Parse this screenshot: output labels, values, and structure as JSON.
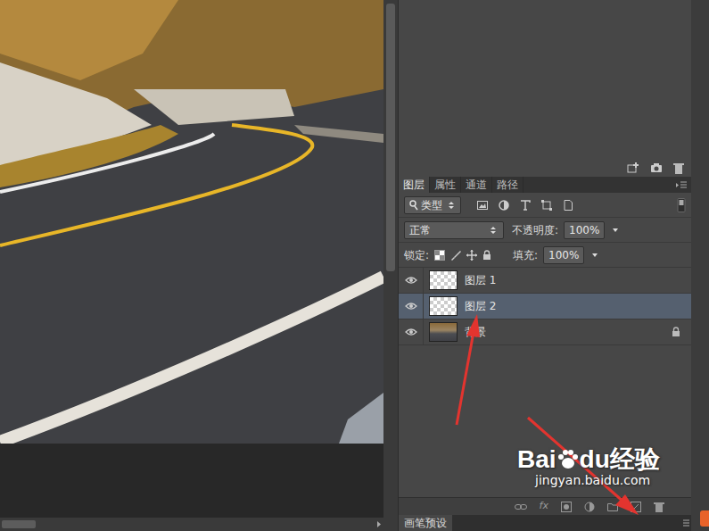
{
  "tabs": [
    {
      "label": "图层",
      "selected": true
    },
    {
      "label": "属性",
      "selected": false
    },
    {
      "label": "通道",
      "selected": false
    },
    {
      "label": "路径",
      "selected": false
    }
  ],
  "filter": {
    "value": "类型"
  },
  "blend_mode": "正常",
  "opacity": {
    "label": "不透明度:",
    "value": "100%"
  },
  "lock": {
    "label": "锁定:"
  },
  "fill": {
    "label": "填充:",
    "value": "100%"
  },
  "layers": [
    {
      "name": "图层 1",
      "visible": true,
      "selected": false,
      "locked": false,
      "kind": "transparent"
    },
    {
      "name": "图层 2",
      "visible": true,
      "selected": true,
      "locked": false,
      "kind": "transparent"
    },
    {
      "name": "背景",
      "visible": true,
      "selected": false,
      "locked": true,
      "kind": "image"
    }
  ],
  "bottom_bar": {
    "fx": "fx"
  },
  "brush_panel": {
    "label": "画笔预设"
  },
  "watermark": {
    "brand_left": "Bai",
    "brand_right": "du经验",
    "url": "jingyan.baidu.com"
  }
}
